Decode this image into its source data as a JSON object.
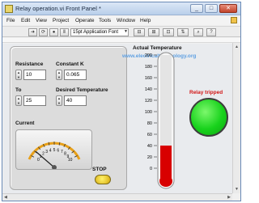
{
  "window": {
    "title": "Relay operation.vi Front Panel *",
    "minimize": "_",
    "maximize": "□",
    "close": "✕"
  },
  "menu": [
    "File",
    "Edit",
    "View",
    "Project",
    "Operate",
    "Tools",
    "Window",
    "Help"
  ],
  "toolbar": {
    "font_label": "15pt Application Font",
    "buttons": [
      "run-arrow",
      "run-continuous",
      "abort",
      "pause",
      "align",
      "distribute",
      "resize",
      "reorder"
    ]
  },
  "controls": {
    "resistance": {
      "label": "Resistance",
      "value": "10"
    },
    "constant_k": {
      "label": "Constant K",
      "value": "0.065"
    },
    "to": {
      "label": "To",
      "value": "25"
    },
    "desired_temperature": {
      "label": "Desired Temperature",
      "value": "40"
    },
    "current": {
      "label": "Current",
      "ticks": [
        "0",
        "1",
        "2",
        "3",
        "4",
        "5",
        "6",
        "7",
        "8",
        "9",
        "10"
      ],
      "needle_value": 1.1
    },
    "stop": {
      "label": "STOP"
    }
  },
  "thermometer": {
    "title": "Actual Temperature",
    "ticks": [
      "200",
      "180",
      "160",
      "140",
      "120",
      "100",
      "80",
      "60",
      "40",
      "20",
      "0"
    ],
    "min": 0,
    "max": 200,
    "value": 40
  },
  "relay": {
    "label": "Relay tripped",
    "led_color": "#18d21c"
  },
  "watermark": "www.electricaltechnology.org",
  "colors": {
    "accent_red": "#d21616",
    "led_green": "#18d21c",
    "stop_yellow": "#f3cf22",
    "mercury_red": "#d80000"
  }
}
